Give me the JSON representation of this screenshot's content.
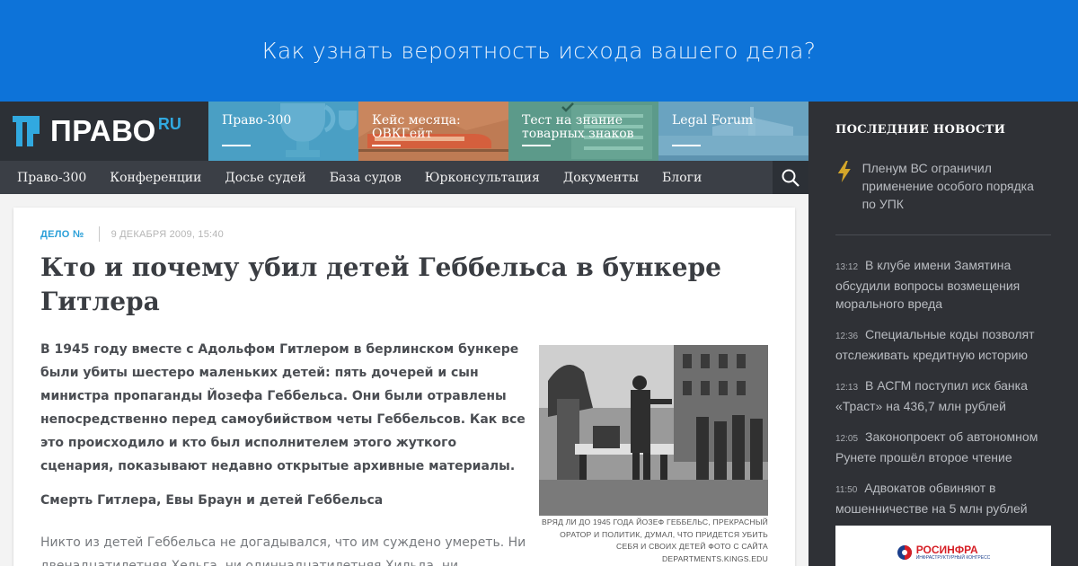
{
  "banner": {
    "text": "Как узнать вероятность исхода вашего дела?"
  },
  "logo": {
    "text": "ПРАВО",
    "suffix": "RU"
  },
  "tiles": [
    {
      "line1": "Право-300",
      "line2": ""
    },
    {
      "line1": "Кейс месяца:",
      "line2": "ОВКГейт"
    },
    {
      "line1": "Тест на знание",
      "line2": "товарных знаков"
    },
    {
      "line1": "Legal Forum",
      "line2": ""
    }
  ],
  "nav": {
    "items": [
      "Право-300",
      "Конференции",
      "Досье судей",
      "База судов",
      "Юрконсультация",
      "Документы",
      "Блоги"
    ],
    "search_icon": "search-icon"
  },
  "article": {
    "tag": "ДЕЛО №",
    "date": "9 ДЕКАБРЯ 2009, 15:40",
    "title": "Кто и почему убил детей Геббельса в бункере Гитлера",
    "lead": "В 1945 году вместе с Адольфом Гитлером в берлинском бункере были убиты шестеро маленьких детей: пять дочерей и сын министра пропаганды Йозефа Геббельса. Они были отравлены непосредственно перед самоубийством четы Геббельсов. Как все это происходило и кто был исполнителем этого жуткого сценария, показывают недавно открытые архивные материалы.",
    "subhead": "Смерть Гитлера, Евы Браун и детей Геббельса",
    "body": "Никто из детей Геббельса не догадывался, что им суждено умереть. Ни двенадцатилетняя Хельга, ни одиннадцатилетняя Хильда, ни",
    "caption": "ВРЯД ЛИ ДО 1945 ГОДА ЙОЗЕФ ГЕББЕЛЬС, ПРЕКРАСНЫЙ ОРАТОР И ПОЛИТИК, ДУМАЛ, ЧТО ПРИДЕТСЯ УБИТЬ СЕБЯ И СВОИХ ДЕТЕЙ ФОТО С САЙТА DEPARTMENTS.KINGS.EDU"
  },
  "sidebar": {
    "title": "ПОСЛЕДНИЕ НОВОСТИ",
    "featured": "Пленум ВС ограничил применение особого порядка по УПК",
    "news": [
      {
        "time": "13:12",
        "text": "В клубе имени Замятина обсудили вопросы возмещения морального вреда"
      },
      {
        "time": "12:36",
        "text": "Специальные коды позволят отслеживать кредитную историю"
      },
      {
        "time": "12:13",
        "text": "В АСГМ поступил иск банка «Траст» на 436,7 млн рублей"
      },
      {
        "time": "12:05",
        "text": "Законопроект об автономном Рунете прошёл второе чтение"
      },
      {
        "time": "11:50",
        "text": "Адвокатов обвиняют в мошенничестве на 5 млн рублей"
      }
    ],
    "ad": {
      "name": "РОСИНФРА",
      "sub": "ИНФРАСТРУКТУРНЫЙ КОНГРЕСС"
    }
  },
  "colors": {
    "banner": "#0d73d9",
    "accent": "#31a9e0",
    "dark": "#2f3136",
    "nav": "#3b3f46"
  }
}
